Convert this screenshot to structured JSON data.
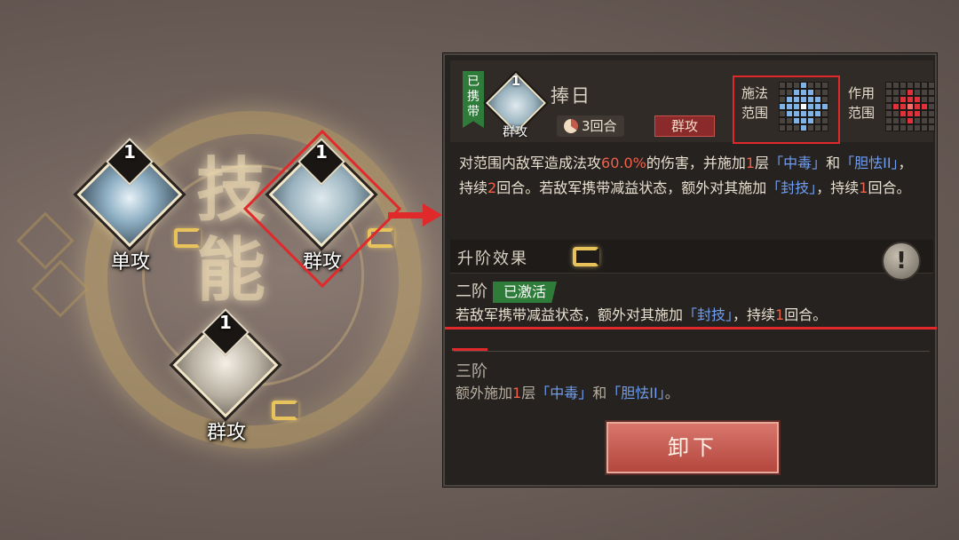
{
  "wheel": {
    "glyph_top": "技",
    "glyph_bottom": "能",
    "slots": [
      {
        "level": "1",
        "label": "单攻",
        "art": "blade-icon"
      },
      {
        "level": "1",
        "label": "群攻",
        "art": "ink-icon",
        "selected": true
      },
      {
        "level": "1",
        "label": "群攻",
        "art": "warrior-icon"
      }
    ]
  },
  "panel": {
    "carried_tag": "已携带",
    "skill_icon_level": "1",
    "skill_icon_type": "群攻",
    "skill_name": "捧日",
    "cooldown": "3回合",
    "attack_type": "群攻",
    "cast_range_label": "施法范围",
    "effect_range_label": "作用范围",
    "description": {
      "p1": "对范围内敌军造成法攻",
      "pct": "60.0%",
      "p2": "的伤害，并施加",
      "n1": "1",
      "p3": "层",
      "poison": "「中毒」",
      "p4": "和",
      "fear": "「胆怯II」",
      "p5": "，持续",
      "n2": "2",
      "p6": "回合。若敌军携带减益状态，额外对其施加",
      "seal": "「封技」",
      "p7": "，持续",
      "n3": "1",
      "p8": "回合。"
    },
    "upgrade_title": "升阶效果",
    "info_icon": "!",
    "tier2": {
      "name": "二阶",
      "status": "已激活",
      "p1": "若敌军携带减益状态，额外对其施加",
      "seal": "「封技」",
      "p2": "，持续",
      "n": "1",
      "p3": "回合。"
    },
    "tier3": {
      "name": "三阶",
      "p1": "额外施加",
      "n": "1",
      "p2": "层",
      "poison": "「中毒」",
      "p3": "和",
      "fear": "「胆怯II」",
      "p4": "。"
    },
    "unload_button": "卸下"
  },
  "colors": {
    "accent_red": "#e0292a",
    "highlight_blue": "#6f9ef2",
    "highlight_red": "#f2604a",
    "active_green": "#2e7b3a"
  }
}
